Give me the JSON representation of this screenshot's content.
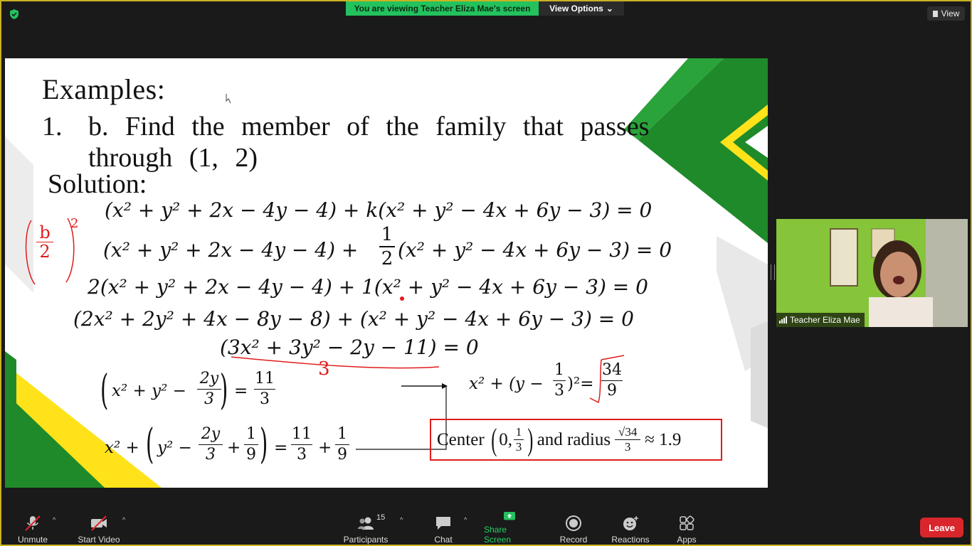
{
  "banner": {
    "viewing_text": "You are viewing Teacher Eliza Mae's screen",
    "view_options_label": "View Options",
    "view_label": "View"
  },
  "slide": {
    "title": "Examples:",
    "problem_number": "1.",
    "problem_text": "b. Find the member of the family that passes through (1, 2)",
    "solution_label": "Solution:",
    "equations": [
      "(x² + y² + 2x − 4y − 4) + k(x² + y² − 4x + 6y − 3) = 0",
      "(x² + y² + 2x − 4y − 4) + ",
      "(x² + y² − 4x + 6y − 3) = 0",
      "2(x² + y² + 2x − 4y − 4) + 1(x² + y² − 4x + 6y − 3) = 0",
      "(2x² + 2y² + 4x − 8y − 8) + (x² + y² − 4x + 6y − 3) = 0",
      "(3x² + 3y² − 2y − 11) = 0"
    ],
    "frac_half": {
      "num": "1",
      "den": "2"
    },
    "step7_left": "x² + y² −",
    "step7_frac": {
      "num": "2y",
      "den": "3"
    },
    "step7_rhs": {
      "num": "11",
      "den": "3"
    },
    "step8_left": "x² +",
    "step8_mid": "y² −",
    "step8_frac1": {
      "num": "2y",
      "den": "3"
    },
    "step8_frac2": {
      "num": "1",
      "den": "9"
    },
    "step8_rhs1": {
      "num": "11",
      "den": "3"
    },
    "step8_rhs2": {
      "num": "1",
      "den": "9"
    },
    "result_left": "x² + (y −",
    "result_frac": {
      "num": "1",
      "den": "3"
    },
    "result_tail": ")²=",
    "result_rhs": {
      "num": "34",
      "den": "9"
    },
    "answer": {
      "center_label": "Center",
      "center_x": "0,",
      "center_frac": {
        "num": "1",
        "den": "3"
      },
      "radius_label": "and radius",
      "radius_num": "√34",
      "radius_den": "3",
      "approx": "≈ 1.9"
    },
    "annotations": {
      "handwritten_fraction": {
        "num": "b",
        "den": "2",
        "exp": "2"
      },
      "handwritten_divisor": "3"
    }
  },
  "participant": {
    "name": "Teacher Eliza Mae"
  },
  "toolbar": {
    "unmute": "Unmute",
    "start_video": "Start Video",
    "participants": "Participants",
    "participants_count": "15",
    "chat": "Chat",
    "share_screen": "Share Screen",
    "record": "Record",
    "reactions": "Reactions",
    "apps": "Apps",
    "leave": "Leave"
  },
  "colors": {
    "share_green": "#23c25e",
    "leave_red": "#d9262c",
    "slide_green": "#1f8a2a",
    "slide_yellow": "#ffe21a",
    "ink_red": "#e01c1c"
  }
}
